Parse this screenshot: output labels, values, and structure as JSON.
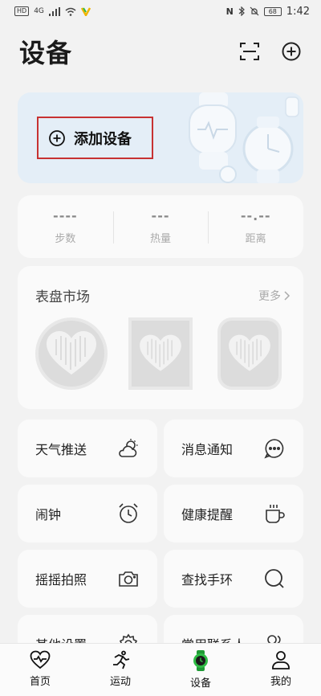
{
  "status_bar": {
    "left_badge": "HD",
    "network": "4G",
    "time": "1:42",
    "battery": "68"
  },
  "header": {
    "title": "设备"
  },
  "banner": {
    "add_device_label": "添加设备"
  },
  "stats": [
    {
      "value": "----",
      "label": "步数"
    },
    {
      "value": "---",
      "label": "热量"
    },
    {
      "value": "--.--",
      "label": "距离"
    }
  ],
  "watch_faces": {
    "title": "表盘市场",
    "more": "更多"
  },
  "tiles": [
    {
      "label": "天气推送",
      "icon": "weather-icon"
    },
    {
      "label": "消息通知",
      "icon": "message-icon"
    },
    {
      "label": "闹钟",
      "icon": "alarm-icon"
    },
    {
      "label": "健康提醒",
      "icon": "cup-icon"
    },
    {
      "label": "摇摇拍照",
      "icon": "camera-icon"
    },
    {
      "label": "查找手环",
      "icon": "search-icon"
    },
    {
      "label": "其他设置",
      "icon": "gear-icon"
    },
    {
      "label": "常用联系人",
      "icon": "contacts-icon"
    }
  ],
  "nav": [
    {
      "label": "首页",
      "icon": "heart-icon"
    },
    {
      "label": "运动",
      "icon": "run-icon"
    },
    {
      "label": "设备",
      "icon": "watch-icon"
    },
    {
      "label": "我的",
      "icon": "person-icon"
    }
  ],
  "colors": {
    "accent": "#2fbd45",
    "highlight_border": "#c73232",
    "banner_bg": "#e4eef7"
  }
}
